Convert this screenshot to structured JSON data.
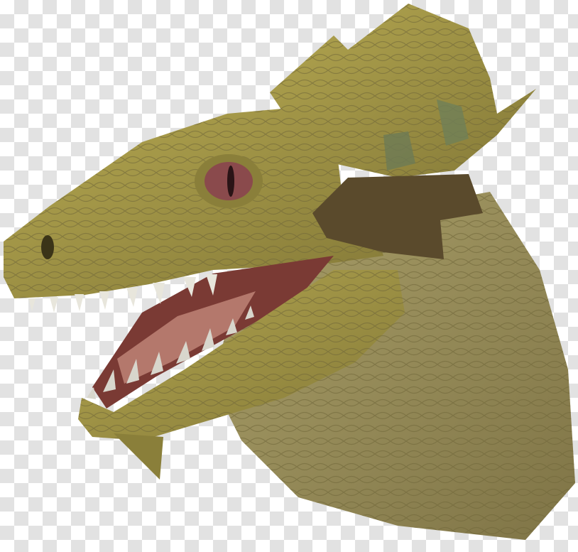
{
  "scene": {
    "subject": "dinosaur-head",
    "background": "transparency-checkerboard",
    "colors": {
      "checker_light": "#ffffff",
      "checker_dark": "#e2e2e2",
      "skin": "#a79b48",
      "skin_shadow": "#7d7236",
      "neck": "#978c5a",
      "eye": "#8a4a4c",
      "mouth": "#7a3a34",
      "tongue": "#b4786c",
      "teeth": "#e8e6dc",
      "strap": "#5a4a2c"
    }
  }
}
